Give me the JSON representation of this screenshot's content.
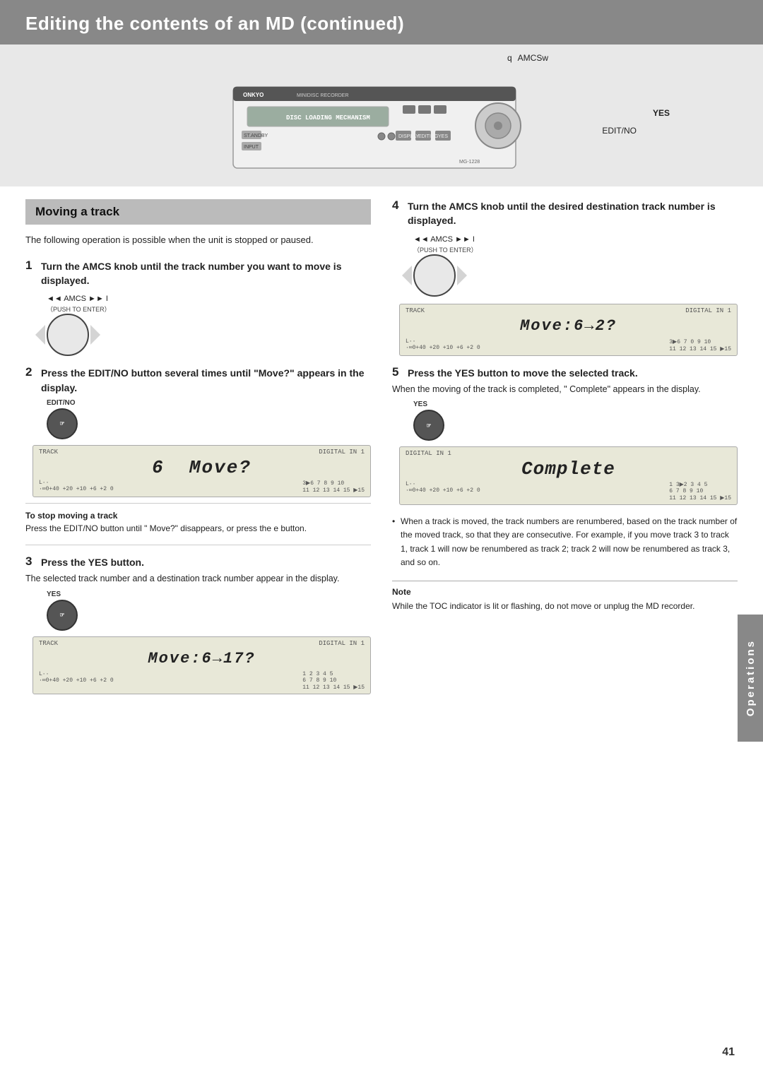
{
  "header": {
    "title": "Editing the contents of an MD (continued)"
  },
  "device_diagram": {
    "q_label": "q",
    "amcsw_label": "AMCSw",
    "yes_label": "YES",
    "editno_label": "EDIT/NO"
  },
  "section": {
    "title": "Moving a track"
  },
  "intro": {
    "text": "The following operation is possible when the unit is stopped or paused."
  },
  "steps": {
    "step1": {
      "num": "1",
      "heading": "Turn the AMCS knob until the track number you want to move is displayed.",
      "amcs_label": "◄◄ AMCS ►► I",
      "push_label": "（PUSH TO ENTER）"
    },
    "step2": {
      "num": "2",
      "heading": "Press the EDIT/NO button several times until \"Move?\" appears in the display.",
      "editno_label": "EDIT/NO",
      "lcd_track": "TRACK",
      "lcd_digital": "DIGITAL IN 1",
      "lcd_main": "6  Move?",
      "lcd_l_meter": "L ··  ·∞0+40  +20  +10  +6  +2 0",
      "lcd_r_meter": "3▶6 7  8  9  10\n11 12 13 14 15 ▶15",
      "to_stop_title": "To stop moving a track",
      "to_stop_text": "Press the EDIT/NO button until \" Move?\" disappears, or press the e button."
    },
    "step3": {
      "num": "3",
      "heading": "Press the YES button.",
      "body": "The selected track number and a destination track number appear in the display.",
      "yes_label": "YES",
      "lcd_main": "Move:6→17?"
    },
    "step4": {
      "num": "4",
      "heading": "Turn the AMCS knob until the desired destination track number is displayed.",
      "amcs_label": "◄◄ AMCS ►► I",
      "push_label": "（PUSH TO ENTER）",
      "lcd_main": "Move:6→2?"
    },
    "step5": {
      "num": "5",
      "heading": "Press the YES button to move the selected track.",
      "body": "When the moving of the track is completed, \" Complete\" appears in the display.",
      "yes_label": "YES",
      "lcd_main": "Complete"
    }
  },
  "bullet_note": {
    "text": "When a track is moved, the track numbers are renumbered, based on the track number of the moved track, so that they are consecutive. For example, if you move track 3 to track 1, track 1 will now be renumbered as track 2; track 2 will now be renumbered as track 3, and so on."
  },
  "note": {
    "title": "Note",
    "text": "While the TOC indicator is lit or flashing, do not move or unplug the MD recorder."
  },
  "operations_tab": {
    "label": "Operations"
  },
  "page_number": "41"
}
